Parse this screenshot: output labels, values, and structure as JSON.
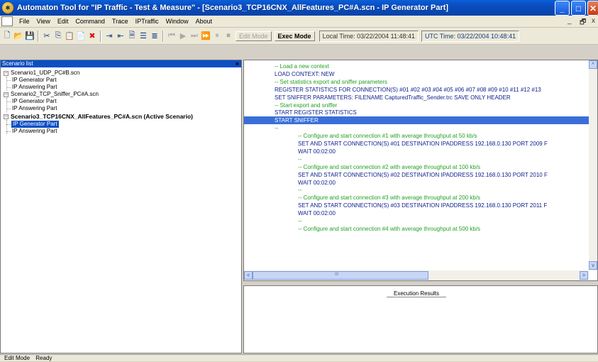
{
  "titlebar": {
    "title": "Automaton Tool for \"IP Traffic - Test & Measure\" - [Scenario3_TCP16CNX_AllFeatures_PC#A.scn - IP Generator Part]",
    "minimize": "_",
    "maximize": "□",
    "close": "✕"
  },
  "menubar": {
    "items": [
      "File",
      "View",
      "Edit",
      "Command",
      "Trace",
      "IPTraffic",
      "Window",
      "About"
    ],
    "mdi_min": "_",
    "mdi_restore": "🗗",
    "mdi_close": "x"
  },
  "toolbar": {
    "edit_mode_label": "Edit Mode",
    "exec_mode_label": "Exec Mode",
    "local_time": "Local Time: 03/22/2004 11:48:41",
    "utc_time": "UTC Time: 03/22/2004 10:48:41"
  },
  "scenario_panel": {
    "header": "Scenario list",
    "close": "×",
    "scenarios": [
      {
        "name": "Scenario1_UDP_PC#B.scn",
        "parts": [
          "IP Generator Part",
          "IP Answering Part"
        ]
      },
      {
        "name": "Scenario2_TCP_Sniffer_PC#A.scn",
        "parts": [
          "IP Generator Part",
          "IP Answering Part"
        ]
      },
      {
        "name": "Scenario3_TCP16CNX_AllFeatures_PC#A.scn (Active Scenario)",
        "parts": [
          "IP Generator Part",
          "IP Answering Part"
        ]
      }
    ]
  },
  "editor": {
    "lines": [
      {
        "text": "-- Load a new context",
        "kind": "comment"
      },
      {
        "text": "LOAD CONTEXT: NEW",
        "kind": "cmd"
      },
      {
        "text": "-- Set statistics export and sniffer parameters",
        "kind": "comment"
      },
      {
        "text": "REGISTER STATISTICS FOR CONNECTION(S)  #01 #02 #03 #04 #05 #06 #07 #08 #09 #10 #11 #12 #13",
        "kind": "cmd"
      },
      {
        "text": "SET SNIFFER PARAMETERS: FILENAME CapturedTraffic_Sender.trc SAVE ONLY HEADER",
        "kind": "cmd"
      },
      {
        "text": "-- Start export and sniffer",
        "kind": "comment"
      },
      {
        "text": "START REGISTER STATISTICS",
        "kind": "cmd"
      },
      {
        "text": "START SNIFFER",
        "kind": "highlight"
      },
      {
        "text": "--",
        "kind": "dots"
      },
      {
        "text": "-- Configure and start connection #1 with average throughput at 50 kb/s",
        "kind": "comment",
        "indent": 1
      },
      {
        "text": "SET AND START CONNECTION(S) #01  DESTINATION IPADDRESS 192.168.0.130 PORT 2009 F",
        "kind": "cmd",
        "indent": 1
      },
      {
        "text": "WAIT 00:02:00",
        "kind": "cmd",
        "indent": 1
      },
      {
        "text": "--",
        "kind": "dots",
        "indent": 1
      },
      {
        "text": "-- Configure and start connection #2 with average throughput at 100 kb/s",
        "kind": "comment",
        "indent": 1
      },
      {
        "text": "SET AND START CONNECTION(S) #02  DESTINATION IPADDRESS 192.168.0.130 PORT 2010 F",
        "kind": "cmd",
        "indent": 1
      },
      {
        "text": "WAIT 00:02:00",
        "kind": "cmd",
        "indent": 1
      },
      {
        "text": "--",
        "kind": "dots",
        "indent": 1
      },
      {
        "text": "-- Configure and start connection #3 with average throughput at 200 kb/s",
        "kind": "comment",
        "indent": 1
      },
      {
        "text": "SET AND START CONNECTION(S) #03  DESTINATION IPADDRESS 192.168.0.130 PORT 2011 F",
        "kind": "cmd",
        "indent": 1
      },
      {
        "text": "WAIT 00:02:00",
        "kind": "cmd",
        "indent": 1
      },
      {
        "text": "--",
        "kind": "dots",
        "indent": 1
      },
      {
        "text": "-- Configure and start connection #4 with average throughput at 500 kb/s",
        "kind": "comment",
        "indent": 1
      }
    ],
    "scroll_left": "<",
    "scroll_right": ">",
    "scroll_up": "^",
    "scroll_down": "v",
    "scroll_grip": "III"
  },
  "results": {
    "title": "Execution Results"
  },
  "statusbar": {
    "mode": "Edit Mode",
    "state": "Ready"
  }
}
